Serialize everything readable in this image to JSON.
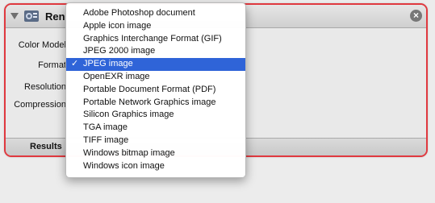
{
  "panel": {
    "title": "Ren",
    "fields": {
      "color_model": "Color Model",
      "format": "Format",
      "resolution": "Resolution",
      "compression": "Compression"
    },
    "footer_tabs": [
      "Results"
    ],
    "accent_color": "#e0393f"
  },
  "format_menu": {
    "items": [
      "Adobe Photoshop document",
      "Apple icon image",
      "Graphics Interchange Format (GIF)",
      "JPEG 2000 image",
      "JPEG image",
      "OpenEXR image",
      "Portable Document Format (PDF)",
      "Portable Network Graphics image",
      "Silicon Graphics image",
      "TGA image",
      "TIFF image",
      "Windows bitmap image",
      "Windows icon image"
    ],
    "selected_index": 4,
    "check_mark": "✓",
    "highlight_color": "#2f64d8"
  }
}
